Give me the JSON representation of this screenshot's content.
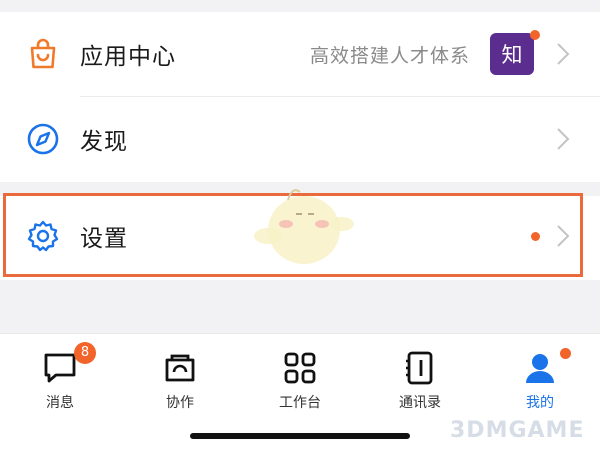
{
  "menu": {
    "app_center": {
      "label": "应用中心",
      "subtitle": "高效搭建人才体系",
      "badge_text": "知"
    },
    "discover": {
      "label": "发现"
    },
    "settings": {
      "label": "设置"
    }
  },
  "tabbar": {
    "messages": {
      "label": "消息",
      "badge": "8"
    },
    "collaborate": {
      "label": "协作"
    },
    "workbench": {
      "label": "工作台"
    },
    "contacts": {
      "label": "通讯录"
    },
    "me": {
      "label": "我的"
    }
  },
  "watermark": "3DMGAME",
  "colors": {
    "accent_blue": "#1a73e8",
    "badge_orange": "#f2642a",
    "highlight_border": "#e86a3d",
    "zhi_purple": "#5a2d8e"
  },
  "icons": {
    "app_center": "shopping-bag-icon",
    "discover": "compass-icon",
    "settings": "gear-icon"
  }
}
